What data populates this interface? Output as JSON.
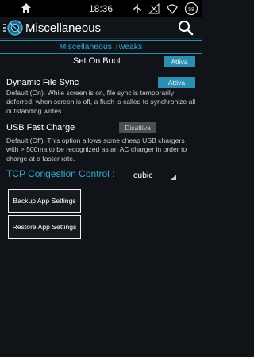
{
  "status_bar": {
    "time": "18:36",
    "battery_text": "58",
    "icons": [
      "home-icon",
      "usb-icon",
      "signal-off-icon",
      "wifi-icon",
      "battery-icon"
    ]
  },
  "action_bar": {
    "title": "Miscellaneous",
    "app_icon": "kernel-app-icon",
    "search_icon": "search-icon"
  },
  "section": {
    "title": "Miscellaneous Tweaks"
  },
  "settings": {
    "set_on_boot": {
      "label": "Set On Boot",
      "state": "Attiva"
    },
    "dynamic_fsync": {
      "label": "Dynamic File Sync",
      "state": "Attiva",
      "desc_lines": [
        "Default (On). While screen is on, file sync is temporarily",
        "deferred, when screen is off, a flush is called to synchronize all",
        "outstanding writes."
      ]
    },
    "usb_fast_charge": {
      "label": "USB Fast Charge",
      "state": "Disattiva",
      "desc_lines": [
        "Default (Off). This option allows some cheap USB chargers",
        "with > 500ma to be recognized as an AC charger in order to",
        "charge at a faster rate."
      ]
    },
    "tcp": {
      "label": "TCP Congestion Control :",
      "value": "cubic"
    }
  },
  "buttons": {
    "backup": "Backup App Settings",
    "restore": "Restore App Settings"
  },
  "colors": {
    "accent": "#2b8fb1",
    "accent_text": "#34a8d1",
    "background": "#101418",
    "off_button": "#4b4f52"
  }
}
